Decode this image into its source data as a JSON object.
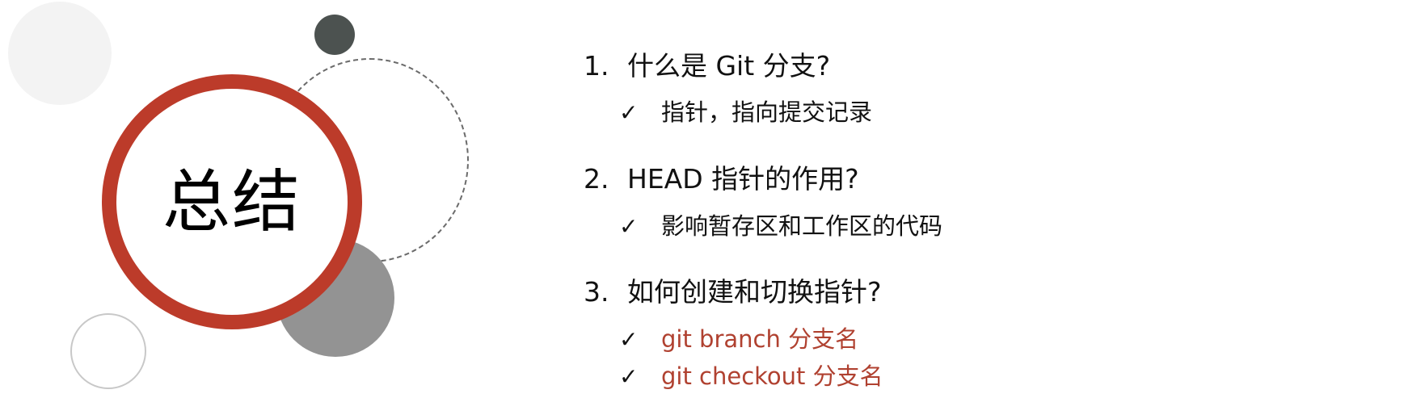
{
  "slide": {
    "title": "总结",
    "items": [
      {
        "number": "1.",
        "question": "什么是 Git 分支?",
        "answers": [
          {
            "check": "✓",
            "text": "指针，指向提交记录",
            "accent": false
          }
        ]
      },
      {
        "number": "2.",
        "question": "HEAD 指针的作用?",
        "answers": [
          {
            "check": "✓",
            "text": "影响暂存区和工作区的代码",
            "accent": false
          }
        ]
      },
      {
        "number": "3.",
        "question": "如何创建和切换指针?",
        "answers": [
          {
            "check": "✓",
            "text": "git branch 分支名",
            "accent": true
          },
          {
            "check": "✓",
            "text": "git checkout 分支名",
            "accent": true
          }
        ]
      }
    ]
  },
  "colors": {
    "ring_red": "#bc3b2a",
    "accent_text": "#b04130",
    "dark_dot": "#4c5250",
    "gray_circle": "#939393",
    "light_circle": "#f3f3f3"
  }
}
